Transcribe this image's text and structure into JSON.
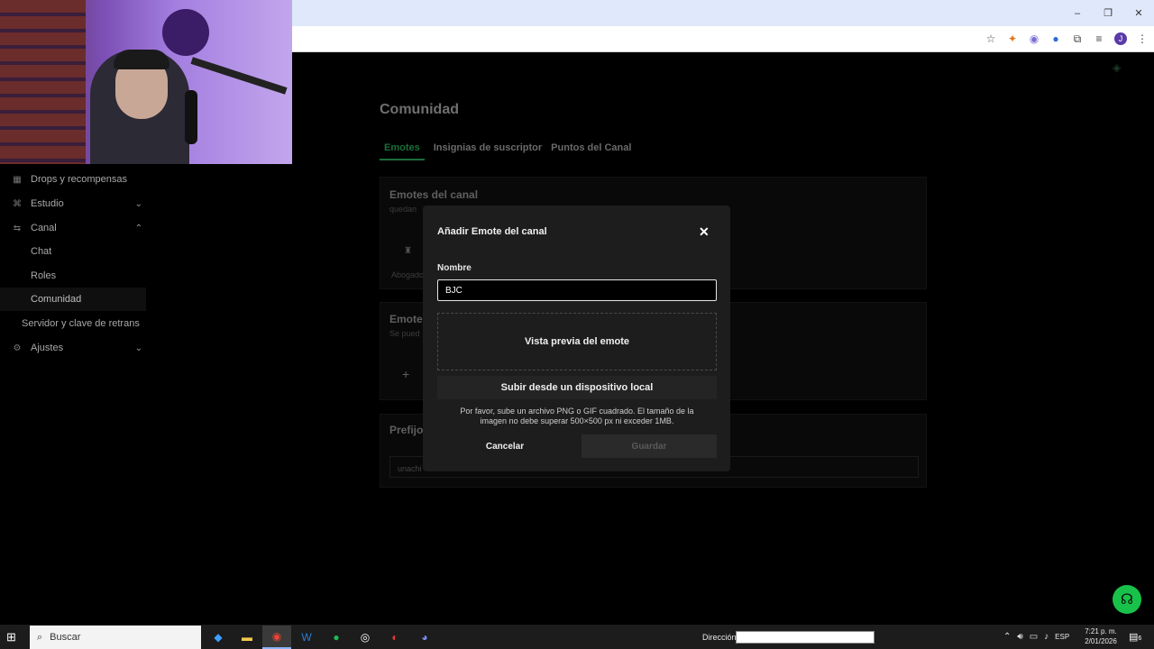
{
  "browser": {
    "window_controls": [
      "–",
      "❐",
      "✕"
    ],
    "toolbar_icons": [
      "star-icon",
      "metamask-icon",
      "extension-icon",
      "extension-icon",
      "puzzle-icon",
      "media-icon"
    ],
    "profile_initial": "J"
  },
  "sidebar": {
    "items": [
      {
        "label": "Drops y recompensas",
        "icon": "gift-icon"
      },
      {
        "label": "Estudio",
        "icon": "studio-icon",
        "chevron": "⌄"
      },
      {
        "label": "Canal",
        "icon": "channel-icon",
        "chevron": "⌃"
      },
      {
        "label": "Chat"
      },
      {
        "label": "Roles"
      },
      {
        "label": "Comunidad"
      },
      {
        "label": "Servidor y clave de retrans"
      },
      {
        "label": "Ajustes",
        "icon": "gear-icon",
        "chevron": "⌄"
      }
    ]
  },
  "page": {
    "title": "Comunidad",
    "tabs": [
      "Emotes",
      "Insignias de suscriptor",
      "Puntos del Canal"
    ],
    "emotes_panel_title": "Emotes del canal",
    "emotes_panel_sub": "quedan",
    "emote_item_label": "Abogado",
    "second_panel_title": "Emote",
    "second_panel_sub": "Se pued",
    "add_symbol": "+",
    "prefix_title": "Prefijo",
    "prefix_value": "unachi"
  },
  "modal": {
    "title": "Añadir Emote del canal",
    "close_symbol": "✕",
    "name_label": "Nombre",
    "name_value": "BJC",
    "preview_label": "Vista previa del emote",
    "upload_label": "Subir desde un dispositivo local",
    "help_text": "Por favor, sube un archivo PNG o GIF cuadrado. El tamaño de la imagen no debe superar 500×500 px ni exceder 1MB.",
    "cancel_label": "Cancelar",
    "save_label": "Guardar"
  },
  "taskbar": {
    "search_placeholder": "Buscar",
    "address_label": "Dirección",
    "language": "ESP",
    "time": "7:21 p. m.",
    "date": "2/01/2026",
    "notification_count": "6"
  }
}
